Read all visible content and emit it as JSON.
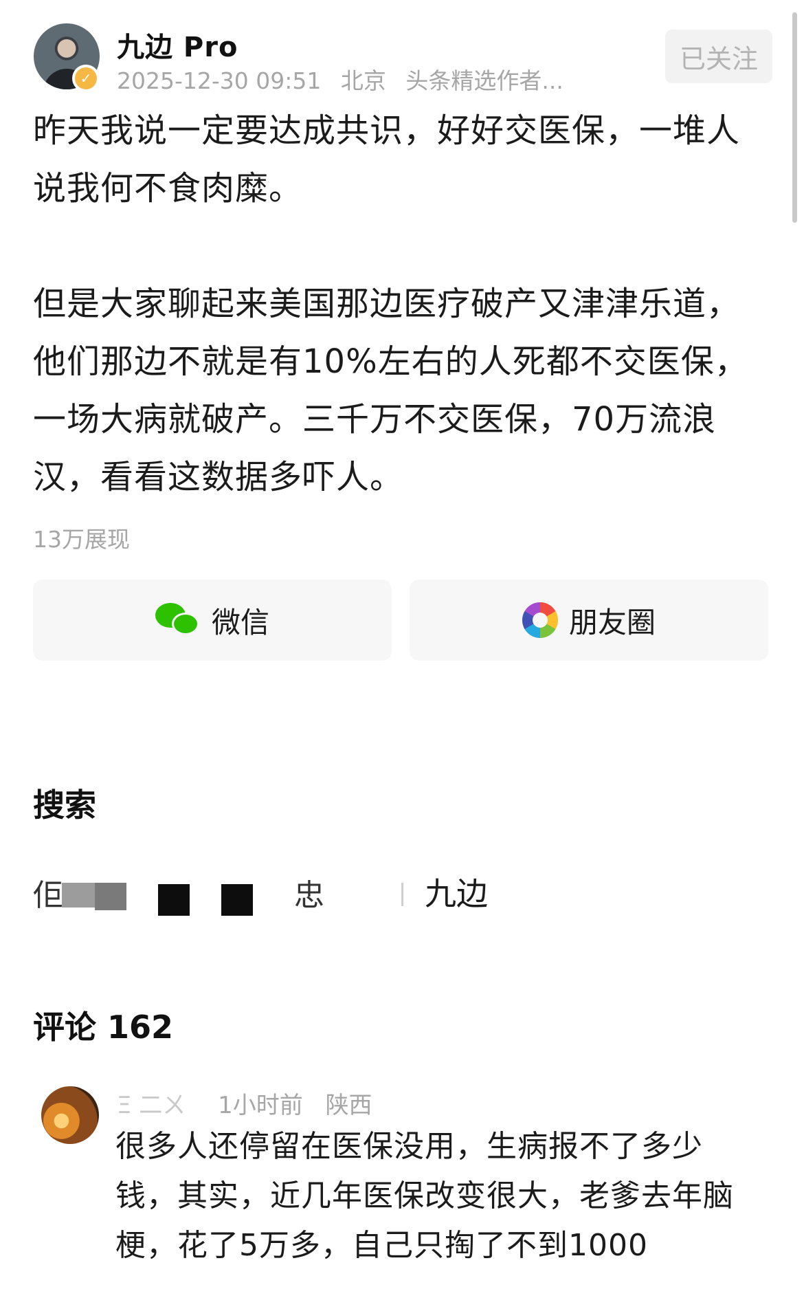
{
  "author": {
    "name": "九边 Pro",
    "timestamp": "2025-12-30 09:51",
    "location": "北京",
    "tag": "头条精选作者...",
    "follow_label": "已关注",
    "badge_color": "#f5b844"
  },
  "post": {
    "paragraph_1": "昨天我说一定要达成共识，好好交医保，一堆人说我何不食肉糜。",
    "paragraph_2": "但是大家聊起来美国那边医疗破产又津津乐道，他们那边不就是有10%左右的人死都不交医保，一场大病就破产。三千万不交医保，70万流浪汉，看看这数据多吓人。",
    "views": "13万展现"
  },
  "share": {
    "wechat_label": "微信",
    "moments_label": "朋友圈",
    "wechat_icon": "wechat-icon",
    "moments_icon": "moments-icon",
    "wechat_color": "#2dc100"
  },
  "search": {
    "title": "搜索",
    "fragment_1": "佢",
    "fragment_2": "忠",
    "item": "九边"
  },
  "comments": {
    "title": "评论 162",
    "items": [
      {
        "name": "Ξ    二ㄨ",
        "time": "1小时前",
        "location": "陕西",
        "text": "很多人还停留在医保没用，生病报不了多少钱，其实，近几年医保改变很大，老爹去年脑梗，花了5万多，自己只掏了不到1000"
      }
    ]
  }
}
